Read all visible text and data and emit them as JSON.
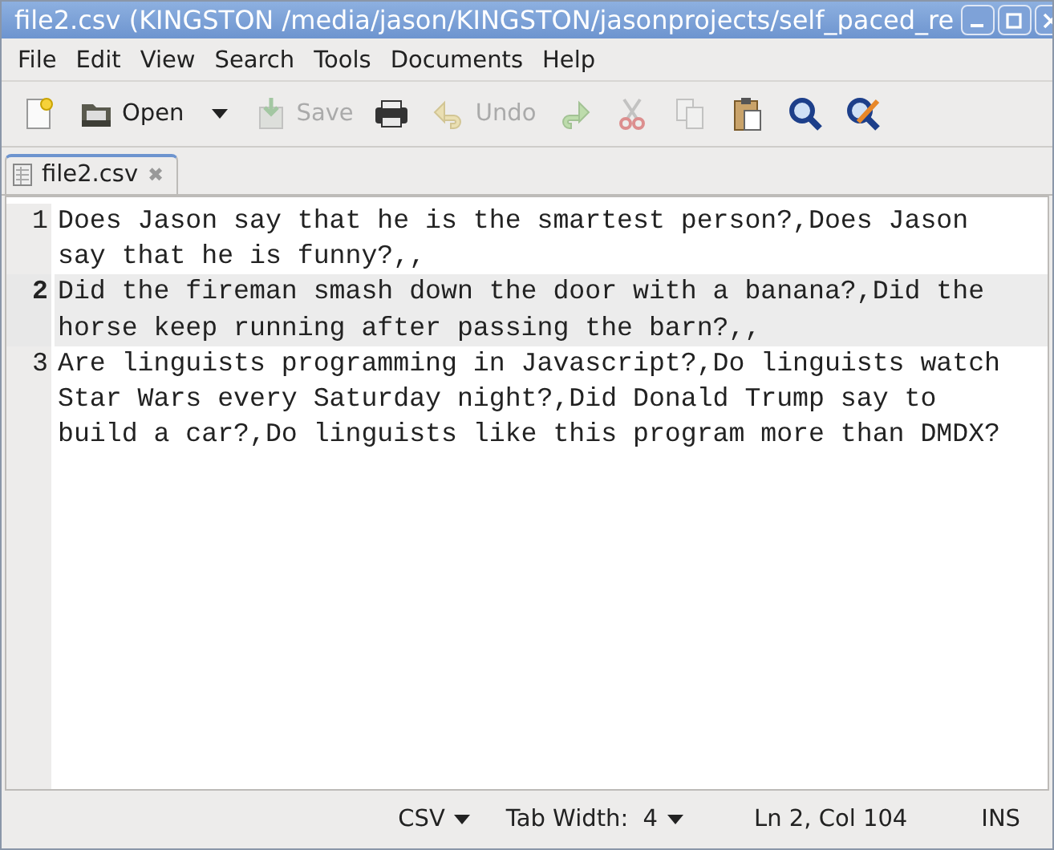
{
  "window": {
    "title": "file2.csv (KINGSTON /media/jason/KINGSTON/jasonprojects/self_paced_re"
  },
  "menu": [
    "File",
    "Edit",
    "View",
    "Search",
    "Tools",
    "Documents",
    "Help"
  ],
  "toolbar": [
    {
      "kind": "new",
      "disabled": false
    },
    {
      "kind": "open",
      "label": "Open",
      "disabled": false
    },
    {
      "kind": "dropdown",
      "disabled": false
    },
    {
      "kind": "save",
      "label": "Save",
      "disabled": true
    },
    {
      "kind": "print",
      "disabled": false
    },
    {
      "kind": "undo",
      "label": "Undo",
      "disabled": true
    },
    {
      "kind": "redo",
      "disabled": true
    },
    {
      "kind": "cut",
      "disabled": true
    },
    {
      "kind": "copy",
      "disabled": true
    },
    {
      "kind": "paste",
      "disabled": false
    },
    {
      "kind": "find",
      "disabled": false
    },
    {
      "kind": "replace",
      "disabled": false
    }
  ],
  "tabs": [
    {
      "label": "file2.csv",
      "close": "✖",
      "selected": true
    }
  ],
  "lines": [
    {
      "number": "1",
      "text": "Does Jason say that he is the smartest person?,Does Jason say that he is funny?,,",
      "selected": false
    },
    {
      "number": "2",
      "text": "Did the fireman smash down the door with a banana?,Did the horse keep running after passing the barn?,,",
      "selected": true
    },
    {
      "number": "3",
      "text": "Are linguists programming in Javascript?,Do linguists watch Star Wars every Saturday night?,Did Donald Trump say to build a car?,Do linguists like this program more than DMDX?",
      "selected": false
    }
  ],
  "status_bar": {
    "language": "CSV",
    "tab_width": "Tab Width:  4",
    "position": "Ln 2, Col 104",
    "mode": "INS"
  }
}
